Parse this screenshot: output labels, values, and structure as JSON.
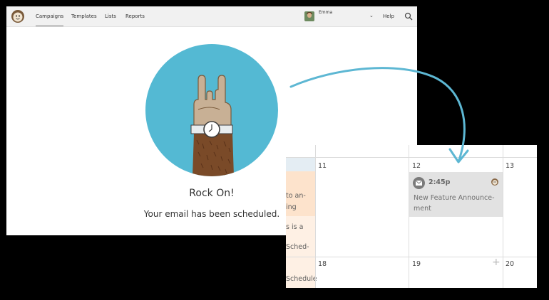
{
  "nav": {
    "items": [
      {
        "label": "Campaigns"
      },
      {
        "label": "Templates"
      },
      {
        "label": "Lists"
      },
      {
        "label": "Reports"
      }
    ],
    "user_name": "Emma",
    "help_label": "Help"
  },
  "confirmation": {
    "title": "Rock On!",
    "message": "Your email has been scheduled."
  },
  "calendar": {
    "days": [
      "11",
      "12",
      "13",
      "18",
      "19",
      "20"
    ],
    "left_column_text": [
      "to an-",
      "ing",
      "s is a",
      "Sched-",
      "Schedule"
    ],
    "event": {
      "time": "2:45p",
      "title": "New Feature Announce-ment"
    },
    "add_symbol": "+"
  },
  "colors": {
    "hero_circle": "#54b9d3",
    "arrow": "#5db7d3",
    "event_bg": "#e2e2e2",
    "highlight_cells": "#fde8d6"
  }
}
